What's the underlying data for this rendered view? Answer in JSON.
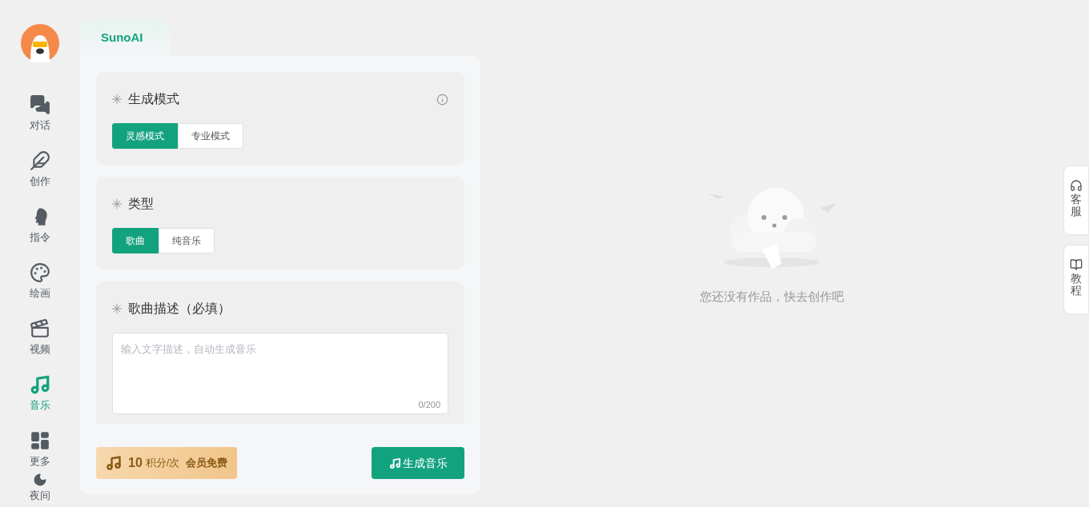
{
  "nav": {
    "items": [
      {
        "label": "对话",
        "kind": "chat",
        "selected": false
      },
      {
        "label": "创作",
        "kind": "feather",
        "selected": false
      },
      {
        "label": "指令",
        "kind": "head",
        "selected": false
      },
      {
        "label": "绘画",
        "kind": "palette",
        "selected": false
      },
      {
        "label": "视频",
        "kind": "video",
        "selected": false
      },
      {
        "label": "音乐",
        "kind": "music",
        "selected": true
      },
      {
        "label": "更多",
        "kind": "grid",
        "selected": false
      }
    ],
    "theme_toggle": {
      "label": "夜间"
    }
  },
  "panel": {
    "tab": "SunoAI",
    "sections": [
      {
        "title": "生成模式",
        "info": true,
        "options": [
          {
            "label": "灵感模式",
            "selected": true
          },
          {
            "label": "专业模式",
            "selected": false
          }
        ]
      },
      {
        "title": "类型",
        "info": false,
        "options": [
          {
            "label": "歌曲",
            "selected": true
          },
          {
            "label": "纯音乐",
            "selected": false
          }
        ]
      }
    ],
    "description": {
      "title": "歌曲描述（必填）",
      "placeholder": "输入文字描述，自动生成音乐",
      "counter": "0/200"
    },
    "cost": {
      "amount": "10",
      "unit": "积分/次",
      "note": "会员免费"
    },
    "submit": "生成音乐"
  },
  "empty_state": {
    "message": "您还没有作品，快去创作吧"
  },
  "side_buttons": [
    {
      "label": "客服",
      "kind": "support"
    },
    {
      "label": "教程",
      "kind": "guide"
    }
  ]
}
